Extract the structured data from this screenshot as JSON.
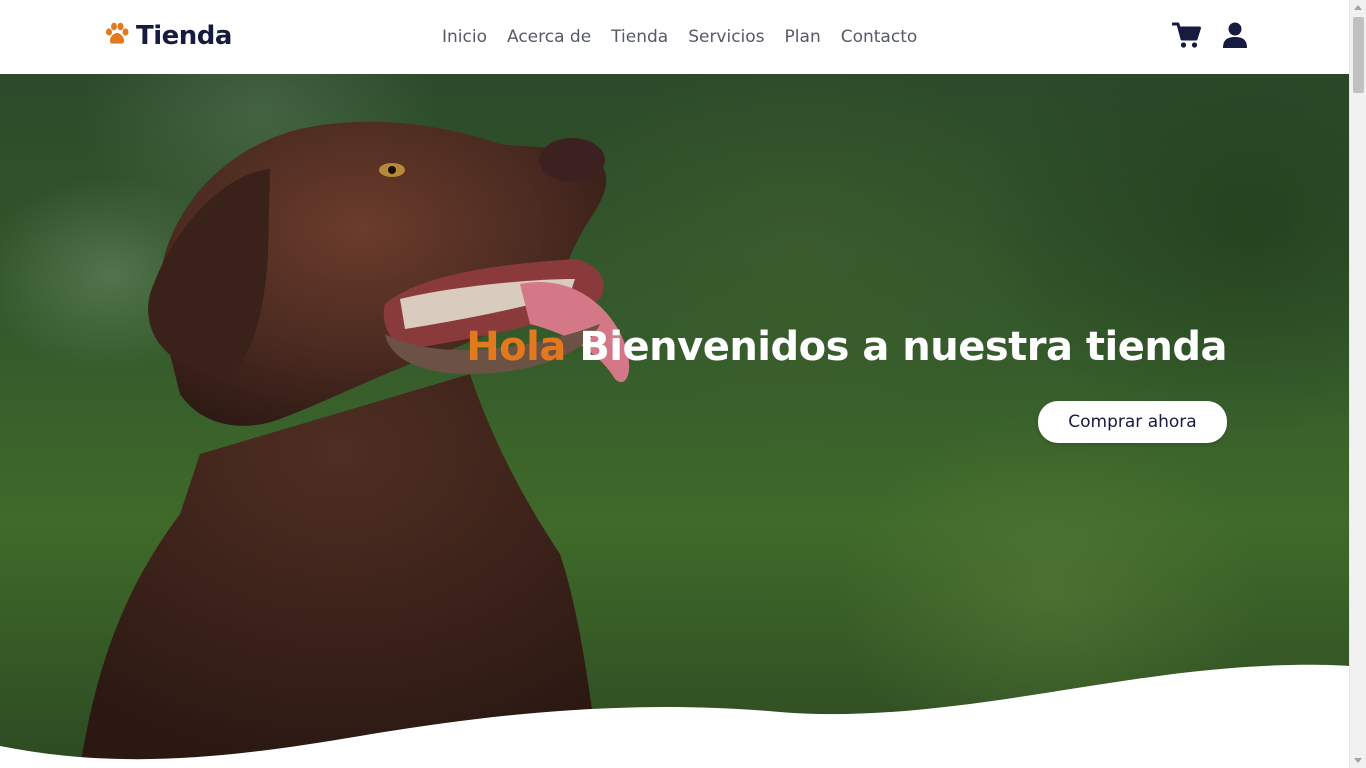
{
  "brand": {
    "name": "Tienda",
    "icon": "paw-icon",
    "accent_color": "#e2791c",
    "text_color": "#161b3f"
  },
  "nav": {
    "items": [
      {
        "label": "Inicio"
      },
      {
        "label": "Acerca de"
      },
      {
        "label": "Tienda"
      },
      {
        "label": "Servicios"
      },
      {
        "label": "Plan"
      },
      {
        "label": "Contacto"
      }
    ]
  },
  "header_icons": {
    "cart": "shopping-cart-icon",
    "user": "user-icon"
  },
  "hero": {
    "title_accent": "Hola",
    "title_rest": "Bienvenidos a nuestra tienda",
    "cta_label": "Comprar ahora",
    "background_color": "#355b2b"
  }
}
